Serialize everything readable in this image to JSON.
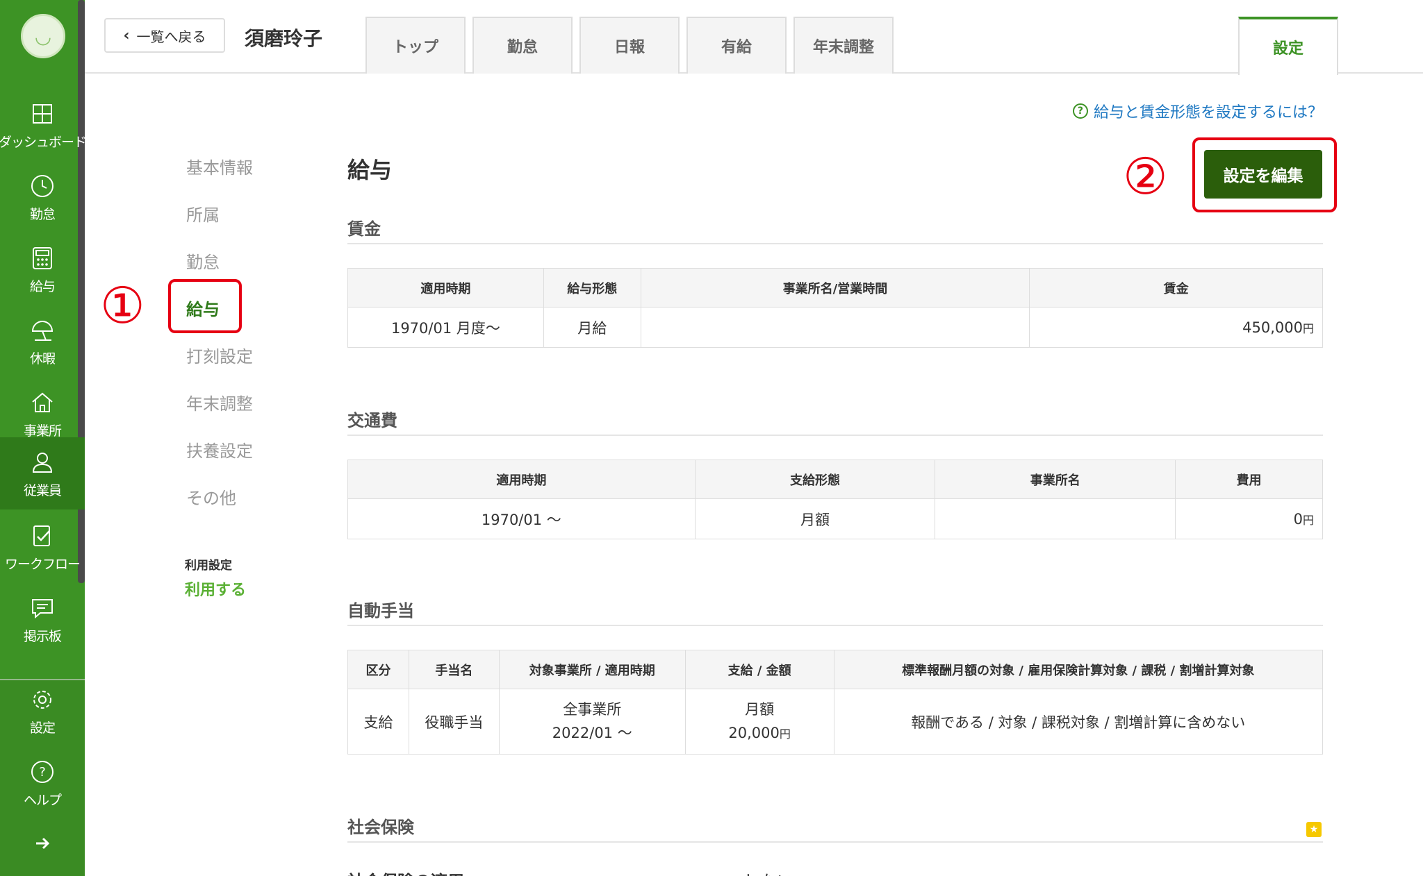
{
  "sidebar": {
    "items": [
      {
        "label": "ダッシュボード",
        "icon": "dashboard-icon"
      },
      {
        "label": "勤怠",
        "icon": "clock-icon"
      },
      {
        "label": "給与",
        "icon": "calculator-icon"
      },
      {
        "label": "休暇",
        "icon": "umbrella-icon"
      },
      {
        "label": "事業所",
        "icon": "home-icon"
      },
      {
        "label": "従業員",
        "icon": "person-icon"
      },
      {
        "label": "ワークフロー",
        "icon": "checklist-icon"
      },
      {
        "label": "掲示板",
        "icon": "chat-icon"
      },
      {
        "label": "設定",
        "icon": "gear-icon"
      },
      {
        "label": "ヘルプ",
        "icon": "help-icon"
      }
    ],
    "active": "従業員"
  },
  "header": {
    "back_label": "一覧へ戻る",
    "employee_name": "須磨玲子",
    "tabs": [
      "トップ",
      "勤怠",
      "日報",
      "有給",
      "年末調整"
    ],
    "settings_tab": "設定"
  },
  "help_link": "給与と賃金形態を設定するには？",
  "subnav": {
    "items": [
      "基本情報",
      "所属",
      "勤怠",
      "給与",
      "打刻設定",
      "年末調整",
      "扶養設定",
      "その他"
    ],
    "active": "給与",
    "usage_label": "利用設定",
    "usage_value": "利用する"
  },
  "annotations": {
    "one": "①",
    "two": "②",
    "accent_color": "#e60012"
  },
  "main": {
    "title": "給与",
    "edit_button": "設定を編集",
    "wage": {
      "title": "賃金",
      "headers": [
        "適用時期",
        "給与形態",
        "事業所名/営業時間",
        "賃金"
      ],
      "row": {
        "period": "1970/01 月度〜",
        "type": "月給",
        "office": "",
        "amount": "450,000",
        "unit": "円"
      }
    },
    "transport": {
      "title": "交通費",
      "headers": [
        "適用時期",
        "支給形態",
        "事業所名",
        "費用"
      ],
      "row": {
        "period": "1970/01 〜",
        "type": "月額",
        "office": "",
        "amount": "0",
        "unit": "円"
      }
    },
    "allowance": {
      "title": "自動手当",
      "headers": [
        "区分",
        "手当名",
        "対象事業所 / 適用時期",
        "支給 / 金額",
        "標準報酬月額の対象 / 雇用保険計算対象 / 課税 / 割増計算対象"
      ],
      "row": {
        "category": "支給",
        "name": "役職手当",
        "office": "全事業所",
        "period": "2022/01 〜",
        "pay_type": "月額",
        "amount": "20,000",
        "unit": "円",
        "flags": "報酬である / 対象 / 課税対象 / 割増計算に含めない"
      }
    },
    "social": {
      "title": "社会保険",
      "partial_label": "社会保険の適用",
      "partial_value": "しない"
    }
  }
}
